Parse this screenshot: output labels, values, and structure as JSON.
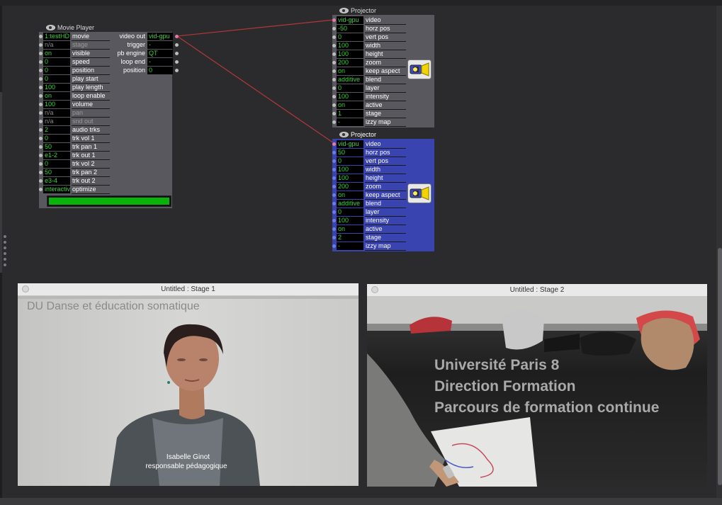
{
  "movie_player": {
    "title": "Movie Player",
    "inputs": [
      {
        "value": "1:testHD",
        "label": "movie",
        "dim": false
      },
      {
        "value": "n/a",
        "label": "stage",
        "dim": true
      },
      {
        "value": "on",
        "label": "visible",
        "dim": false
      },
      {
        "value": "0",
        "label": "speed",
        "dim": false
      },
      {
        "value": "0",
        "label": "position",
        "dim": false
      },
      {
        "value": "0",
        "label": "play start",
        "dim": false
      },
      {
        "value": "100",
        "label": "play length",
        "dim": false
      },
      {
        "value": "on",
        "label": "loop enable",
        "dim": false
      },
      {
        "value": "100",
        "label": "volume",
        "dim": false
      },
      {
        "value": "n/a",
        "label": "pan",
        "dim": true
      },
      {
        "value": "n/a",
        "label": "snd out",
        "dim": true
      },
      {
        "value": "2",
        "label": "audio trks",
        "dim": false
      },
      {
        "value": "0",
        "label": "trk vol 1",
        "dim": false
      },
      {
        "value": "50",
        "label": "trk pan 1",
        "dim": false
      },
      {
        "value": "e1-2",
        "label": "trk out 1",
        "dim": false
      },
      {
        "value": "0",
        "label": "trk vol 2",
        "dim": false
      },
      {
        "value": "50",
        "label": "trk pan 2",
        "dim": false
      },
      {
        "value": "e3-4",
        "label": "trk out 2",
        "dim": false
      },
      {
        "value": "interactive",
        "label": "optimize",
        "dim": false
      }
    ],
    "outputs": [
      {
        "label": "video out",
        "value": "vid-gpu"
      },
      {
        "label": "trigger",
        "value": "-"
      },
      {
        "label": "pb engine",
        "value": "QT"
      },
      {
        "label": "loop end",
        "value": "-"
      },
      {
        "label": "position",
        "value": "0"
      }
    ],
    "progress": 1.0,
    "progress_color": "#0ab30a"
  },
  "projectors": [
    {
      "title": "Projector",
      "bg": "#58585e",
      "dot_color": "grey",
      "inputs": [
        {
          "value": "vid-gpu",
          "label": "video"
        },
        {
          "value": "-50",
          "label": "horz pos"
        },
        {
          "value": "0",
          "label": "vert pos"
        },
        {
          "value": "100",
          "label": "width"
        },
        {
          "value": "100",
          "label": "height"
        },
        {
          "value": "200",
          "label": "zoom"
        },
        {
          "value": "on",
          "label": "keep aspect"
        },
        {
          "value": "additive",
          "label": "blend"
        },
        {
          "value": "0",
          "label": "layer"
        },
        {
          "value": "100",
          "label": "intensity"
        },
        {
          "value": "on",
          "label": "active"
        },
        {
          "value": "1",
          "label": "stage"
        },
        {
          "value": "-",
          "label": "izzy map"
        }
      ]
    },
    {
      "title": "Projector",
      "bg": "#3a44b0",
      "dot_color": "blue",
      "inputs": [
        {
          "value": "vid-gpu",
          "label": "video"
        },
        {
          "value": "50",
          "label": "horz pos"
        },
        {
          "value": "0",
          "label": "vert pos"
        },
        {
          "value": "100",
          "label": "width"
        },
        {
          "value": "100",
          "label": "height"
        },
        {
          "value": "200",
          "label": "zoom"
        },
        {
          "value": "on",
          "label": "keep aspect"
        },
        {
          "value": "additive",
          "label": "blend"
        },
        {
          "value": "0",
          "label": "layer"
        },
        {
          "value": "100",
          "label": "intensity"
        },
        {
          "value": "on",
          "label": "active"
        },
        {
          "value": "2",
          "label": "stage"
        },
        {
          "value": "-",
          "label": "izzy map"
        }
      ]
    }
  ],
  "connection_color": "#b0383a",
  "stage1": {
    "title": "Untitled : Stage 1",
    "overlay_text": "DU Danse et éducation somatique",
    "caption_name": "Isabelle Ginot",
    "caption_role": "responsable pédagogique"
  },
  "stage2": {
    "title": "Untitled : Stage 2",
    "lines": [
      "Université Paris 8",
      "Direction Formation",
      "Parcours de formation continue"
    ]
  },
  "icons": [
    "eye-icon",
    "projector-icon"
  ]
}
